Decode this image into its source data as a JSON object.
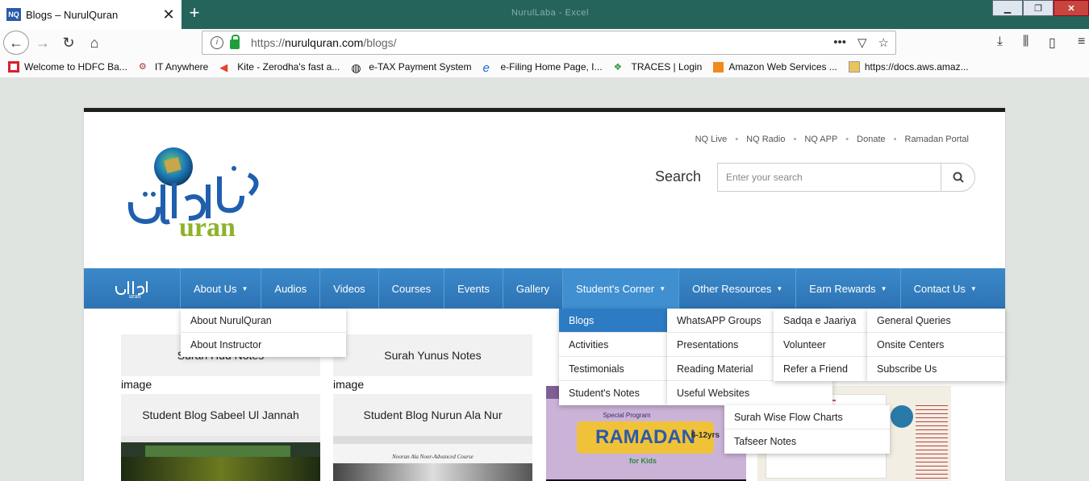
{
  "browser": {
    "tab_title": "Blogs – NurulQuran",
    "tab_favicon": "NQ",
    "window_title": "NurulLaba - Excel",
    "url_prefix": "https://",
    "url_host": "nurulquran.com",
    "url_path": "/blogs/"
  },
  "bookmarks": [
    {
      "label": "Welcome to HDFC Ba...",
      "icon": "hdfc-icon"
    },
    {
      "label": "IT Anywhere",
      "icon": "it-anywhere-icon"
    },
    {
      "label": "Kite - Zerodha's fast a...",
      "icon": "kite-icon"
    },
    {
      "label": "e-TAX Payment System",
      "icon": "globe-icon"
    },
    {
      "label": "e-Filing Home Page, I...",
      "icon": "efiling-icon"
    },
    {
      "label": "TRACES | Login",
      "icon": "traces-icon"
    },
    {
      "label": "Amazon Web Services ...",
      "icon": "aws-icon"
    },
    {
      "label": "https://docs.aws.amaz...",
      "icon": "docs-icon"
    }
  ],
  "header": {
    "top_links": [
      "NQ Live",
      "NQ Radio",
      "NQ APP",
      "Donate",
      "Ramadan Portal"
    ],
    "search_label": "Search",
    "search_placeholder": "Enter your search",
    "logo_latin": "uran"
  },
  "nav": {
    "items": [
      {
        "label": "About Us",
        "caret": true
      },
      {
        "label": "Audios",
        "caret": false
      },
      {
        "label": "Videos",
        "caret": false
      },
      {
        "label": "Courses",
        "caret": false
      },
      {
        "label": "Events",
        "caret": false
      },
      {
        "label": "Gallery",
        "caret": false
      },
      {
        "label": "Student's Corner",
        "caret": true
      },
      {
        "label": "Other Resources",
        "caret": true
      },
      {
        "label": "Earn Rewards",
        "caret": true
      },
      {
        "label": "Contact Us",
        "caret": true
      }
    ]
  },
  "dropdowns": {
    "about_us": [
      "About NurulQuran",
      "About Instructor"
    ],
    "students_corner": [
      "Blogs",
      "Activities",
      "Testimonials",
      "Student's Notes"
    ],
    "other_resources": [
      "WhatsAPP Groups",
      "Presentations",
      "Reading Material",
      "Useful Websites",
      "Surah Wise Flow Charts",
      "Tafseer Notes"
    ],
    "earn_rewards": [
      "Sadqa e Jaariya",
      "Volunteer",
      "Refer a Friend"
    ],
    "contact_us": [
      "General Queries",
      "Onsite Centers",
      "Subscribe Us"
    ]
  },
  "cards": {
    "c1_title": "Surah Hud Notes",
    "c2_title": "Surah Yunus Notes",
    "img_label_1": "image",
    "img_label_2": "image",
    "c3_title": "Student Blog Sabeel Ul Jannah",
    "c4_title": "Student Blog Nurun Ala Nur",
    "thumb4_caption": "Nooran Ala Noor-Advanced Course",
    "ramadan_title": "RAMADAN",
    "ramadan_sub": "for Kids",
    "ramadan_badge": "Special Program",
    "ramadan_age": "6-12yrs"
  },
  "colors": {
    "nav_blue": "#2d73b4",
    "dropdown_selected": "#2d7bc3",
    "tab_bar": "#25645a"
  }
}
